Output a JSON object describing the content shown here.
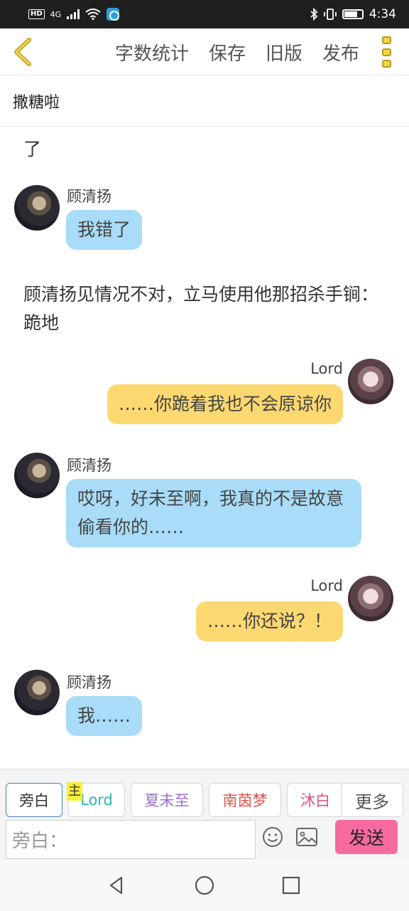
{
  "status_bar": {
    "left_badge": "HD",
    "network": "4G",
    "time": "4:34"
  },
  "toolbar": {
    "items": [
      "字数统计",
      "保存",
      "旧版",
      "发布"
    ]
  },
  "title": "撒糖啦",
  "chat": {
    "top_fragment": "了",
    "messages": [
      {
        "type": "character",
        "name": "顾清扬",
        "text": "我错了"
      },
      {
        "type": "narration",
        "text": "顾清扬见情况不对，立马使用他那招杀手锏：跪地"
      },
      {
        "type": "self",
        "name": "Lord",
        "text": "……你跪着我也不会原谅你"
      },
      {
        "type": "character",
        "name": "顾清扬",
        "text": "哎呀，好未至啊，我真的不是故意偷看你的……"
      },
      {
        "type": "self",
        "name": "Lord",
        "text": "……你还说？！"
      },
      {
        "type": "character",
        "name": "顾清扬",
        "text": "我……"
      }
    ]
  },
  "roles": {
    "host_badge": "主",
    "chips": [
      {
        "label": "旁白",
        "color": "#777777"
      },
      {
        "label": "Lord",
        "color": "#2bb6b0"
      },
      {
        "label": "夏未至",
        "color": "#9b6fd1"
      },
      {
        "label": "南茵梦",
        "color": "#e0524a"
      },
      {
        "label": "沐白",
        "color": "#e0508a"
      },
      {
        "label": "更多",
        "color": "#555555"
      }
    ]
  },
  "composer": {
    "placeholder": "旁白：",
    "send_label": "发送"
  },
  "colors": {
    "bubble_left": "#a8dcf8",
    "bubble_right": "#fcd871",
    "send": "#f66aa0",
    "accent_icon": "#f7d64a"
  }
}
